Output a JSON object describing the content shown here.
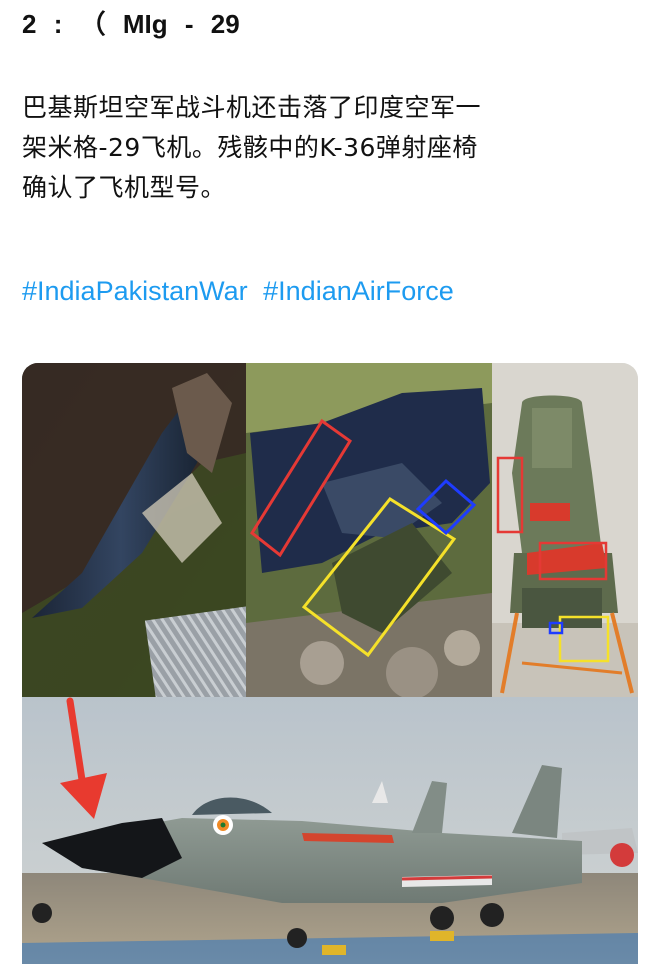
{
  "tweet": {
    "header_parts": [
      "2",
      ":",
      "（",
      "MIg",
      "-",
      "29"
    ],
    "body_lines": [
      "巴基斯坦空军战斗机还击落了印度空军一",
      "架米格-29飞机。残骸中的K-36弹射座椅",
      "确认了飞机型号。"
    ],
    "hashtags": [
      "#IndiaPakistanWar",
      "#IndianAirForce"
    ]
  },
  "media": {
    "panels": [
      "wreck-closeup-photo",
      "wreckage-annotated-photo",
      "ejection-seat-photo",
      "mig29-parked-photo"
    ],
    "annotation_colors": {
      "red": "#e53935",
      "yellow": "#f5e12a",
      "blue": "#1e3cff"
    }
  }
}
